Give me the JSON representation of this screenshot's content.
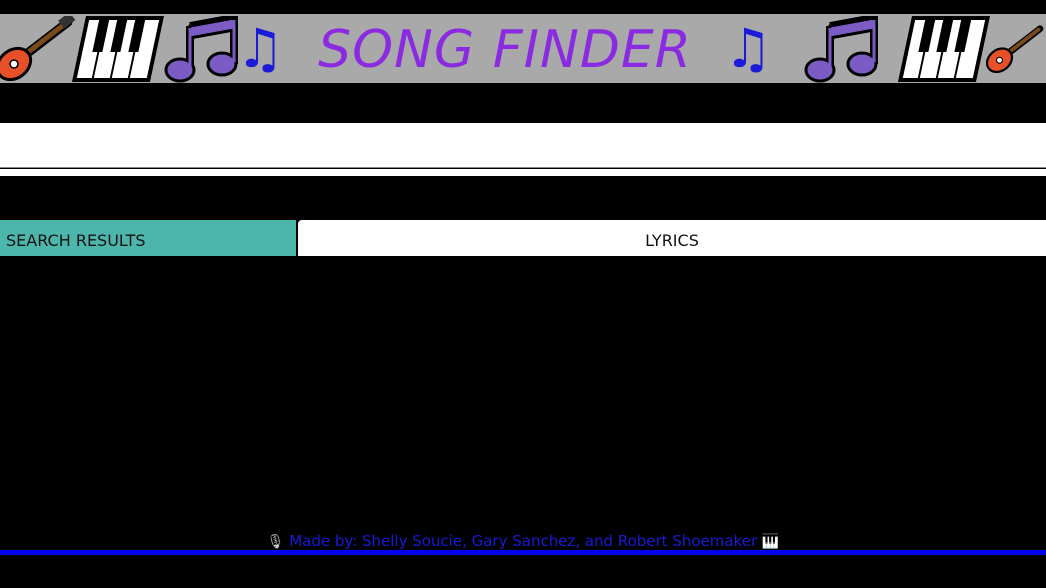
{
  "header": {
    "title": "SONG FINDER",
    "icons": [
      "guitar-icon",
      "piano-keys-icon",
      "double-note-icon",
      "single-note-icon"
    ]
  },
  "search": {
    "value": "",
    "placeholder": ""
  },
  "panels": {
    "results_label": "SEARCH RESULTS",
    "lyrics_label": "LYRICS"
  },
  "footer": {
    "left_icon": "microphone-icon",
    "credit_text": "Made by: Shelly Soucie, Gary Sanchez, and Robert Shoemaker",
    "right_icon": "piano-icon"
  },
  "colors": {
    "background": "#000000",
    "banner": "#a9a9a9",
    "title": "#8a2be2",
    "note": "#1a1ad8",
    "results_header": "#4db6ac",
    "footer_link": "#1a1ad8",
    "footer_rule": "#0000ee"
  }
}
